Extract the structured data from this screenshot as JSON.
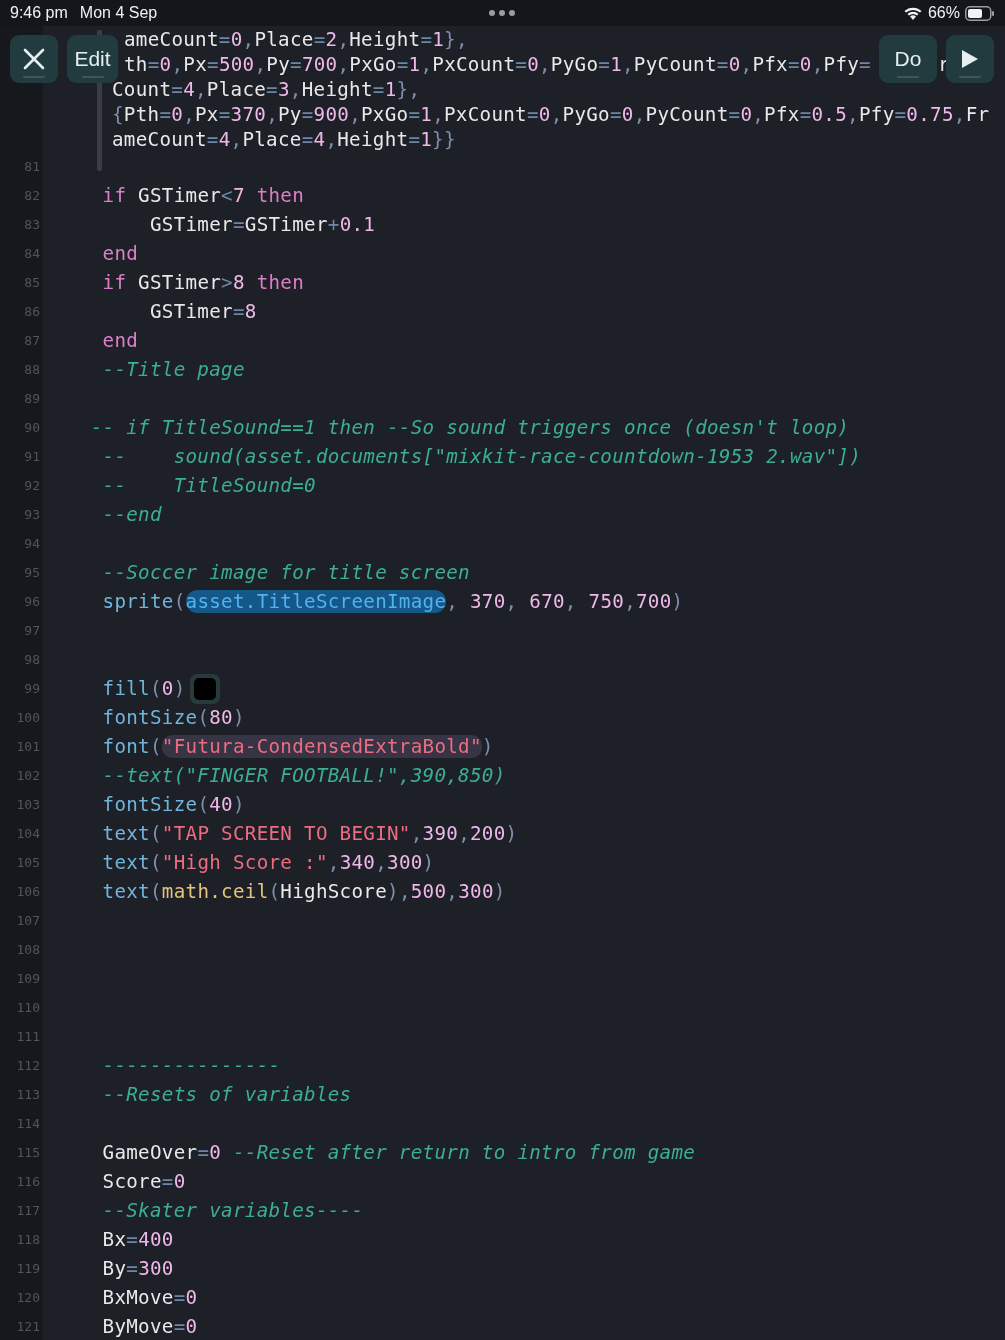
{
  "status_bar": {
    "time": "9:46 pm",
    "date": "Mon 4 Sep",
    "battery": "66%"
  },
  "toolbar": {
    "left": [
      {
        "kind": "close"
      },
      {
        "kind": "text",
        "label": "Edit"
      }
    ],
    "right": [
      {
        "kind": "text",
        "label": "Do"
      },
      {
        "kind": "play"
      }
    ]
  },
  "wrapped_lines": [
    {
      "first_letter_hidden": true,
      "tokens": [
        {
          "kind": "id",
          "text": "ameCount"
        },
        {
          "kind": "op",
          "text": "="
        },
        {
          "kind": "num",
          "text": "0"
        },
        {
          "kind": "punc",
          "text": ","
        },
        {
          "kind": "id",
          "text": "Place"
        },
        {
          "kind": "op",
          "text": "="
        },
        {
          "kind": "num",
          "text": "2"
        },
        {
          "kind": "punc",
          "text": ","
        },
        {
          "kind": "id",
          "text": "Height"
        },
        {
          "kind": "op",
          "text": "="
        },
        {
          "kind": "num",
          "text": "1"
        },
        {
          "kind": "punc",
          "text": "},"
        }
      ]
    },
    {
      "first_letter_hidden": true,
      "tokens": [
        {
          "kind": "id",
          "text": "th"
        },
        {
          "kind": "op",
          "text": "="
        },
        {
          "kind": "num",
          "text": "0"
        },
        {
          "kind": "punc",
          "text": ","
        },
        {
          "kind": "id",
          "text": "Px"
        },
        {
          "kind": "op",
          "text": "="
        },
        {
          "kind": "num",
          "text": "500"
        },
        {
          "kind": "punc",
          "text": ","
        },
        {
          "kind": "id",
          "text": "Py"
        },
        {
          "kind": "op",
          "text": "="
        },
        {
          "kind": "num",
          "text": "700"
        },
        {
          "kind": "punc",
          "text": ","
        },
        {
          "kind": "id",
          "text": "PxGo"
        },
        {
          "kind": "op",
          "text": "="
        },
        {
          "kind": "num",
          "text": "1"
        },
        {
          "kind": "punc",
          "text": ","
        },
        {
          "kind": "id",
          "text": "PxCount"
        },
        {
          "kind": "op",
          "text": "="
        },
        {
          "kind": "num",
          "text": "0"
        },
        {
          "kind": "punc",
          "text": ","
        },
        {
          "kind": "id",
          "text": "PyGo"
        },
        {
          "kind": "op",
          "text": "="
        },
        {
          "kind": "num",
          "text": "1"
        },
        {
          "kind": "punc",
          "text": ","
        },
        {
          "kind": "id",
          "text": "PyCount"
        },
        {
          "kind": "op",
          "text": "="
        },
        {
          "kind": "num",
          "text": "0"
        },
        {
          "kind": "punc",
          "text": ","
        },
        {
          "kind": "id",
          "text": "Pfx"
        },
        {
          "kind": "op",
          "text": "="
        },
        {
          "kind": "num",
          "text": "0"
        },
        {
          "kind": "punc",
          "text": ","
        },
        {
          "kind": "id",
          "text": "Pfy"
        },
        {
          "kind": "op",
          "text": "="
        },
        {
          "kind": "gap"
        },
        {
          "kind": "id",
          "text": "r"
        }
      ]
    },
    {
      "tokens": [
        {
          "kind": "id",
          "text": "Count"
        },
        {
          "kind": "op",
          "text": "="
        },
        {
          "kind": "num",
          "text": "4"
        },
        {
          "kind": "punc",
          "text": ","
        },
        {
          "kind": "id",
          "text": "Place"
        },
        {
          "kind": "op",
          "text": "="
        },
        {
          "kind": "num",
          "text": "3"
        },
        {
          "kind": "punc",
          "text": ","
        },
        {
          "kind": "id",
          "text": "Height"
        },
        {
          "kind": "op",
          "text": "="
        },
        {
          "kind": "num",
          "text": "1"
        },
        {
          "kind": "punc",
          "text": "},"
        }
      ]
    },
    {
      "tokens": [
        {
          "kind": "punc",
          "text": "{"
        },
        {
          "kind": "id",
          "text": "Pth"
        },
        {
          "kind": "op",
          "text": "="
        },
        {
          "kind": "num",
          "text": "0"
        },
        {
          "kind": "punc",
          "text": ","
        },
        {
          "kind": "id",
          "text": "Px"
        },
        {
          "kind": "op",
          "text": "="
        },
        {
          "kind": "num",
          "text": "370"
        },
        {
          "kind": "punc",
          "text": ","
        },
        {
          "kind": "id",
          "text": "Py"
        },
        {
          "kind": "op",
          "text": "="
        },
        {
          "kind": "num",
          "text": "900"
        },
        {
          "kind": "punc",
          "text": ","
        },
        {
          "kind": "id",
          "text": "PxGo"
        },
        {
          "kind": "op",
          "text": "="
        },
        {
          "kind": "num",
          "text": "1"
        },
        {
          "kind": "punc",
          "text": ","
        },
        {
          "kind": "id",
          "text": "PxCount"
        },
        {
          "kind": "op",
          "text": "="
        },
        {
          "kind": "num",
          "text": "0"
        },
        {
          "kind": "punc",
          "text": ","
        },
        {
          "kind": "id",
          "text": "PyGo"
        },
        {
          "kind": "op",
          "text": "="
        },
        {
          "kind": "num",
          "text": "0"
        },
        {
          "kind": "punc",
          "text": ","
        },
        {
          "kind": "id",
          "text": "PyCount"
        },
        {
          "kind": "op",
          "text": "="
        },
        {
          "kind": "num",
          "text": "0"
        },
        {
          "kind": "punc",
          "text": ","
        },
        {
          "kind": "id",
          "text": "Pfx"
        },
        {
          "kind": "op",
          "text": "="
        },
        {
          "kind": "num",
          "text": "0.5"
        },
        {
          "kind": "punc",
          "text": ","
        },
        {
          "kind": "id",
          "text": "Pfy"
        },
        {
          "kind": "op",
          "text": "="
        },
        {
          "kind": "num",
          "text": "0.75"
        },
        {
          "kind": "punc",
          "text": ","
        },
        {
          "kind": "id",
          "text": "Fr"
        }
      ]
    },
    {
      "tokens": [
        {
          "kind": "id",
          "text": "ameCount"
        },
        {
          "kind": "op",
          "text": "="
        },
        {
          "kind": "num",
          "text": "4"
        },
        {
          "kind": "punc",
          "text": ","
        },
        {
          "kind": "id",
          "text": "Place"
        },
        {
          "kind": "op",
          "text": "="
        },
        {
          "kind": "num",
          "text": "4"
        },
        {
          "kind": "punc",
          "text": ","
        },
        {
          "kind": "id",
          "text": "Height"
        },
        {
          "kind": "op",
          "text": "="
        },
        {
          "kind": "num",
          "text": "1"
        },
        {
          "kind": "punc",
          "text": "}}"
        }
      ]
    }
  ],
  "lines": [
    {
      "number": "81"
    },
    {
      "number": "82",
      "tokens": [
        {
          "kind": "kw",
          "text": "   if"
        },
        {
          "kind": "id",
          "text": " GSTimer"
        },
        {
          "kind": "op",
          "text": "<"
        },
        {
          "kind": "num",
          "text": "7"
        },
        {
          "kind": "kw",
          "text": " then"
        }
      ]
    },
    {
      "number": "83",
      "tokens": [
        {
          "kind": "id",
          "text": "       GSTimer"
        },
        {
          "kind": "op",
          "text": "="
        },
        {
          "kind": "id",
          "text": "GSTimer"
        },
        {
          "kind": "op",
          "text": "+"
        },
        {
          "kind": "num",
          "text": "0.1"
        }
      ]
    },
    {
      "number": "84",
      "tokens": [
        {
          "kind": "kw",
          "text": "   end"
        }
      ]
    },
    {
      "number": "85",
      "tokens": [
        {
          "kind": "kw",
          "text": "   if"
        },
        {
          "kind": "id",
          "text": " GSTimer"
        },
        {
          "kind": "op",
          "text": ">"
        },
        {
          "kind": "num",
          "text": "8"
        },
        {
          "kind": "kw",
          "text": " then"
        }
      ]
    },
    {
      "number": "86",
      "tokens": [
        {
          "kind": "id",
          "text": "       GSTimer"
        },
        {
          "kind": "op",
          "text": "="
        },
        {
          "kind": "num",
          "text": "8"
        }
      ]
    },
    {
      "number": "87",
      "tokens": [
        {
          "kind": "kw",
          "text": "   end"
        }
      ]
    },
    {
      "number": "88",
      "tokens": [
        {
          "kind": "com",
          "text": "   --Title page"
        }
      ]
    },
    {
      "number": "89"
    },
    {
      "number": "90",
      "tokens": [
        {
          "kind": "com",
          "text": "  -- if TitleSound==1 then --So sound triggers once (doesn't loop)"
        }
      ]
    },
    {
      "number": "91",
      "tokens": [
        {
          "kind": "com",
          "text": "   --    sound(asset.documents[\"mixkit-race-countdown-1953 2.wav\"])"
        }
      ]
    },
    {
      "number": "92",
      "tokens": [
        {
          "kind": "com",
          "text": "   --    TitleSound=0"
        }
      ]
    },
    {
      "number": "93",
      "tokens": [
        {
          "kind": "com",
          "text": "   --end"
        }
      ]
    },
    {
      "number": "94"
    },
    {
      "number": "95",
      "tokens": [
        {
          "kind": "com",
          "text": "   --Soccer image for title screen"
        }
      ]
    },
    {
      "number": "96",
      "tokens": [
        {
          "kind": "fn",
          "text": "   sprite"
        },
        {
          "kind": "punc",
          "text": "("
        },
        {
          "kind": "asset",
          "text": "asset.TitleScreenImage"
        },
        {
          "kind": "punc",
          "text": ", "
        },
        {
          "kind": "num",
          "text": "370"
        },
        {
          "kind": "punc",
          "text": ", "
        },
        {
          "kind": "num",
          "text": "670"
        },
        {
          "kind": "punc",
          "text": ", "
        },
        {
          "kind": "num",
          "text": "750"
        },
        {
          "kind": "punc",
          "text": ","
        },
        {
          "kind": "num",
          "text": "700"
        },
        {
          "kind": "punc",
          "text": ")"
        }
      ]
    },
    {
      "number": "97"
    },
    {
      "number": "98"
    },
    {
      "number": "99",
      "tokens": [
        {
          "kind": "fn",
          "text": "   fill"
        },
        {
          "kind": "punc",
          "text": "("
        },
        {
          "kind": "num",
          "text": "0"
        },
        {
          "kind": "punc",
          "text": ")"
        },
        {
          "kind": "swatch"
        }
      ]
    },
    {
      "number": "100",
      "tokens": [
        {
          "kind": "fn",
          "text": "   fontSize"
        },
        {
          "kind": "punc",
          "text": "("
        },
        {
          "kind": "num",
          "text": "80"
        },
        {
          "kind": "punc",
          "text": ")"
        }
      ]
    },
    {
      "number": "101",
      "tokens": [
        {
          "kind": "fn",
          "text": "   font"
        },
        {
          "kind": "punc",
          "text": "("
        },
        {
          "kind": "strhl",
          "text": "\"Futura-CondensedExtraBold\""
        },
        {
          "kind": "punc",
          "text": ")"
        }
      ]
    },
    {
      "number": "102",
      "tokens": [
        {
          "kind": "com",
          "text": "   --text(\"FINGER FOOTBALL!\",390,850)"
        }
      ]
    },
    {
      "number": "103",
      "tokens": [
        {
          "kind": "fn",
          "text": "   fontSize"
        },
        {
          "kind": "punc",
          "text": "("
        },
        {
          "kind": "num",
          "text": "40"
        },
        {
          "kind": "punc",
          "text": ")"
        }
      ]
    },
    {
      "number": "104",
      "tokens": [
        {
          "kind": "fn",
          "text": "   text"
        },
        {
          "kind": "punc",
          "text": "("
        },
        {
          "kind": "str",
          "text": "\"TAP SCREEN TO BEGIN\""
        },
        {
          "kind": "punc",
          "text": ","
        },
        {
          "kind": "num",
          "text": "390"
        },
        {
          "kind": "punc",
          "text": ","
        },
        {
          "kind": "num",
          "text": "200"
        },
        {
          "kind": "punc",
          "text": ")"
        }
      ]
    },
    {
      "number": "105",
      "tokens": [
        {
          "kind": "fn",
          "text": "   text"
        },
        {
          "kind": "punc",
          "text": "("
        },
        {
          "kind": "str",
          "text": "\"High Score :\""
        },
        {
          "kind": "punc",
          "text": ","
        },
        {
          "kind": "num",
          "text": "340"
        },
        {
          "kind": "punc",
          "text": ","
        },
        {
          "kind": "num",
          "text": "300"
        },
        {
          "kind": "punc",
          "text": ")"
        }
      ]
    },
    {
      "number": "106",
      "tokens": [
        {
          "kind": "fn",
          "text": "   text"
        },
        {
          "kind": "punc",
          "text": "("
        },
        {
          "kind": "lib",
          "text": "math.ceil"
        },
        {
          "kind": "punc",
          "text": "("
        },
        {
          "kind": "id",
          "text": "HighScore"
        },
        {
          "kind": "punc",
          "text": ")"
        },
        {
          "kind": "punc",
          "text": ","
        },
        {
          "kind": "num",
          "text": "500"
        },
        {
          "kind": "punc",
          "text": ","
        },
        {
          "kind": "num",
          "text": "300"
        },
        {
          "kind": "punc",
          "text": ")"
        }
      ]
    },
    {
      "number": "107"
    },
    {
      "number": "108"
    },
    {
      "number": "109"
    },
    {
      "number": "110"
    },
    {
      "number": "111"
    },
    {
      "number": "112",
      "tokens": [
        {
          "kind": "com",
          "text": "   ---------------"
        }
      ]
    },
    {
      "number": "113",
      "tokens": [
        {
          "kind": "com",
          "text": "   --Resets of variables"
        }
      ]
    },
    {
      "number": "114"
    },
    {
      "number": "115",
      "tokens": [
        {
          "kind": "id",
          "text": "   GameOver"
        },
        {
          "kind": "op",
          "text": "="
        },
        {
          "kind": "num",
          "text": "0"
        },
        {
          "kind": "com",
          "text": " --Reset after return to intro from game"
        }
      ]
    },
    {
      "number": "116",
      "tokens": [
        {
          "kind": "id",
          "text": "   Score"
        },
        {
          "kind": "op",
          "text": "="
        },
        {
          "kind": "num",
          "text": "0"
        }
      ]
    },
    {
      "number": "117",
      "tokens": [
        {
          "kind": "com",
          "text": "   --Skater variables----"
        }
      ]
    },
    {
      "number": "118",
      "tokens": [
        {
          "kind": "id",
          "text": "   Bx"
        },
        {
          "kind": "op",
          "text": "="
        },
        {
          "kind": "num",
          "text": "400"
        }
      ]
    },
    {
      "number": "119",
      "tokens": [
        {
          "kind": "id",
          "text": "   By"
        },
        {
          "kind": "op",
          "text": "="
        },
        {
          "kind": "num",
          "text": "300"
        }
      ]
    },
    {
      "number": "120",
      "tokens": [
        {
          "kind": "id",
          "text": "   BxMove"
        },
        {
          "kind": "op",
          "text": "="
        },
        {
          "kind": "num",
          "text": "0"
        }
      ]
    },
    {
      "number": "121",
      "tokens": [
        {
          "kind": "id",
          "text": "   ByMove"
        },
        {
          "kind": "op",
          "text": "="
        },
        {
          "kind": "num",
          "text": "0"
        }
      ]
    }
  ]
}
